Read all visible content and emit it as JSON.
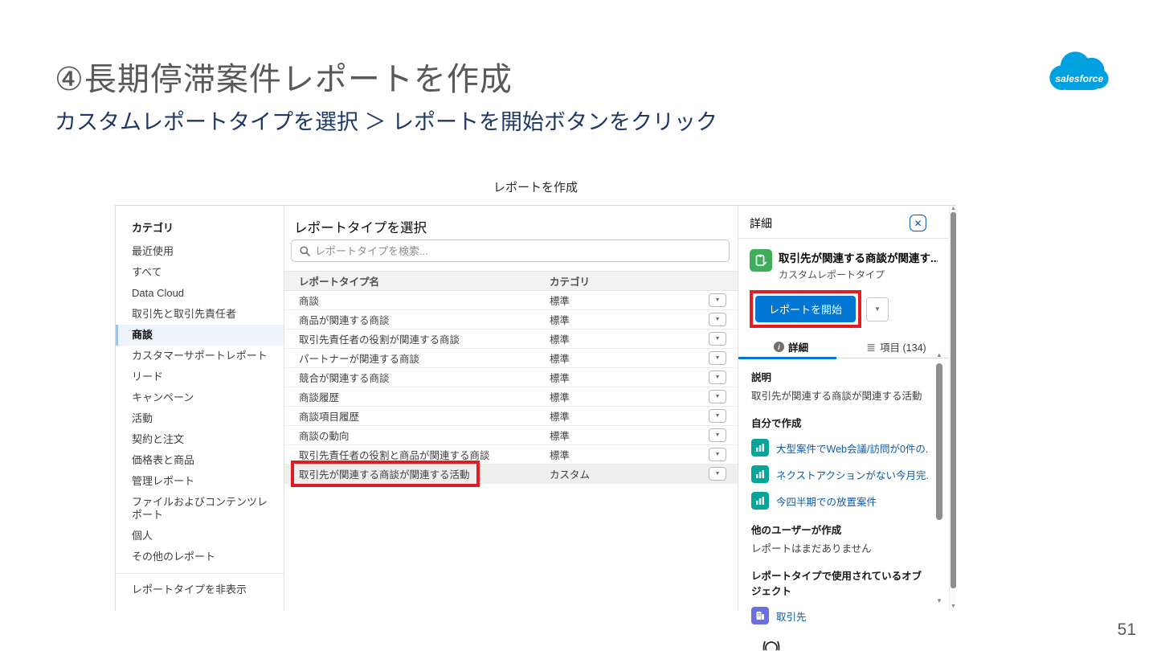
{
  "colors": {
    "sf-blue": "#00a1e0",
    "btn-blue": "#0176d3",
    "link": "#0b5cab",
    "navy": "#1f3864",
    "title-gray": "#595959",
    "red": "#e31b23",
    "green": "#3fae5a",
    "teal": "#06a59a",
    "indigo": "#6b6fe0"
  },
  "slide": {
    "title": "④長期停滞案件レポートを作成",
    "subtitle": "カスタムレポートタイプを選択 ＞ レポートを開始ボタンをクリック",
    "page_number": "51",
    "logo_text": "salesforce"
  },
  "dialog": {
    "title": "レポートを作成",
    "sidebar": {
      "header": "カテゴリ",
      "items": [
        {
          "label": "最近使用",
          "selected": false
        },
        {
          "label": "すべて",
          "selected": false
        },
        {
          "label": "Data Cloud",
          "selected": false
        },
        {
          "label": "取引先と取引先責任者",
          "selected": false
        },
        {
          "label": "商談",
          "selected": true
        },
        {
          "label": "カスタマーサポートレポート",
          "selected": false
        },
        {
          "label": "リード",
          "selected": false
        },
        {
          "label": "キャンペーン",
          "selected": false
        },
        {
          "label": "活動",
          "selected": false
        },
        {
          "label": "契約と注文",
          "selected": false
        },
        {
          "label": "価格表と商品",
          "selected": false
        },
        {
          "label": "管理レポート",
          "selected": false
        },
        {
          "label": "ファイルおよびコンテンツレポート",
          "selected": false
        },
        {
          "label": "個人",
          "selected": false
        },
        {
          "label": "その他のレポート",
          "selected": false
        }
      ],
      "footer_item": "レポートタイプを非表示"
    },
    "main": {
      "title": "レポートタイプを選択",
      "search_placeholder": "レポートタイプを検索...",
      "columns": [
        "レポートタイプ名",
        "カテゴリ"
      ],
      "rows": [
        {
          "name": "商談",
          "category": "標準",
          "selected": false,
          "highlighted": false
        },
        {
          "name": "商品が関連する商談",
          "category": "標準",
          "selected": false,
          "highlighted": false
        },
        {
          "name": "取引先責任者の役割が関連する商談",
          "category": "標準",
          "selected": false,
          "highlighted": false
        },
        {
          "name": "パートナーが関連する商談",
          "category": "標準",
          "selected": false,
          "highlighted": false
        },
        {
          "name": "競合が関連する商談",
          "category": "標準",
          "selected": false,
          "highlighted": false
        },
        {
          "name": "商談履歴",
          "category": "標準",
          "selected": false,
          "highlighted": false
        },
        {
          "name": "商談項目履歴",
          "category": "標準",
          "selected": false,
          "highlighted": false
        },
        {
          "name": "商談の動向",
          "category": "標準",
          "selected": false,
          "highlighted": false
        },
        {
          "name": "取引先責任者の役割と商品が関連する商談",
          "category": "標準",
          "selected": false,
          "highlighted": false
        },
        {
          "name": "取引先が関連する商談が関連する活動",
          "category": "カスタム",
          "selected": true,
          "highlighted": true
        }
      ]
    },
    "detail": {
      "header": "詳細",
      "type_title": "取引先が関連する商談が関連す...",
      "type_subtitle": "カスタムレポートタイプ",
      "start_button": "レポートを開始",
      "tabs": [
        {
          "label": "詳細",
          "active": true
        },
        {
          "label": "項目 (134)",
          "active": false
        }
      ],
      "description_label": "説明",
      "description": "取引先が関連する商談が関連する活動",
      "created_by_me_label": "自分で作成",
      "my_reports": [
        "大型案件でWeb会議/訪問が0件の...",
        "ネクストアクションがない今月完...",
        "今四半期での放置案件"
      ],
      "created_by_others_label": "他のユーザーが作成",
      "no_reports_text": "レポートはまだありません",
      "objects_label": "レポートタイプで使用されているオブジェクト",
      "objects": [
        "取引先"
      ]
    }
  }
}
